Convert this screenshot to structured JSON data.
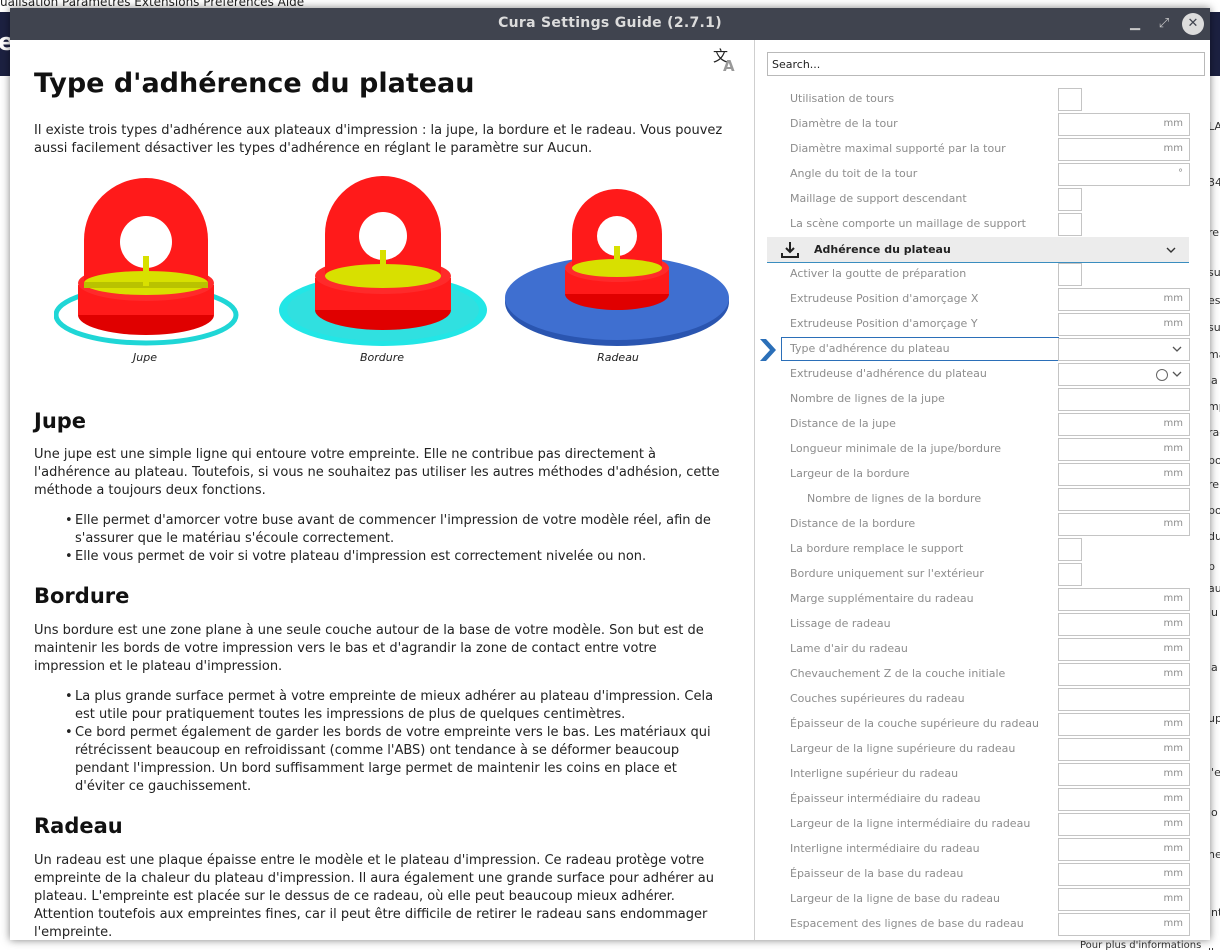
{
  "background": {
    "menubar": "ualisation  Paramètres  Extensions  Préférences  Aide",
    "header_letter": "er",
    "right_fragments": [
      "LA",
      "34",
      "re",
      "sup",
      "es",
      "su",
      "ma",
      "la",
      "mp",
      "rac",
      "po",
      "re s",
      "po",
      "du",
      "p",
      "au",
      "ju",
      "la",
      "up",
      "l'e",
      "io",
      "hev",
      "int",
      "lle"
    ],
    "bottom_fragment": "Pour plus d'informations"
  },
  "window": {
    "title": "Cura Settings Guide (2.7.1)",
    "minimize_glyph": "▁",
    "maximize_glyph": "⤢",
    "close_glyph": "✕"
  },
  "article": {
    "title": "Type d'adhérence du plateau",
    "intro": "Il existe trois types d'adhérence aux plateaux d'impression : la jupe, la bordure et le radeau. Vous pouvez aussi facilement désactiver les types d'adhérence en réglant le paramètre sur Aucun.",
    "figures": [
      {
        "caption": "Jupe"
      },
      {
        "caption": "Bordure"
      },
      {
        "caption": "Radeau"
      }
    ],
    "sections": [
      {
        "heading": "Jupe",
        "text": "Une jupe est une simple ligne qui entoure votre empreinte. Elle ne contribue pas directement à l'adhérence au plateau. Toutefois, si vous ne souhaitez pas utiliser les autres méthodes d'adhésion, cette méthode a toujours deux fonctions.",
        "bullets": [
          "Elle permet d'amorcer votre buse avant de commencer l'impression de votre modèle réel, afin de s'assurer que le matériau s'écoule correctement.",
          "Elle vous permet de voir si votre plateau d'impression est correctement nivelée ou non."
        ]
      },
      {
        "heading": "Bordure",
        "text": "Uns bordure est une zone plane à une seule couche autour de la base de votre modèle. Son but est de maintenir les bords de votre impression vers le bas et d'agrandir la zone de contact entre votre impression et le plateau d'impression.",
        "bullets": [
          "La plus grande surface permet à votre empreinte de mieux adhérer au plateau d'impression. Cela est utile pour pratiquement toutes les impressions de plus de quelques centimètres.",
          "Ce bord permet également de garder les bords de votre empreinte vers le bas. Les matériaux qui rétrécissent beaucoup en refroidissant (comme l'ABS) ont tendance à se déformer beaucoup pendant l'impression. Un bord suffisamment large permet de maintenir les coins en place et d'éviter ce gauchissement."
        ]
      },
      {
        "heading": "Radeau",
        "text": "Un radeau est une plaque épaisse entre le modèle et le plateau d'impression. Ce radeau protège votre empreinte de la chaleur du plateau d'impression. Il aura également une grande surface pour adhérer au plateau. L'empreinte est placée sur le dessus de ce radeau, où elle peut beaucoup mieux adhérer. Attention toutefois aux empreintes fines, car il peut être difficile de retirer le radeau sans endommager l'empreinte."
      }
    ],
    "colors": {
      "model_red": "#ff1a1a",
      "model_yellow": "#d8e000",
      "skirt_cyan": "#1fd6d6",
      "brim_cyan": "#22e6e6",
      "raft_blue": "#3f6fd0"
    }
  },
  "settings": {
    "search_placeholder": "Search...",
    "support_rows": [
      {
        "label": "Utilisation de tours",
        "kind": "check"
      },
      {
        "label": "Diamètre de la tour",
        "kind": "field",
        "unit": "mm"
      },
      {
        "label": "Diamètre maximal supporté par la tour",
        "kind": "field",
        "unit": "mm"
      },
      {
        "label": "Angle du toit de la tour",
        "kind": "field",
        "unit": "°"
      },
      {
        "label": "Maillage de support descendant",
        "kind": "check"
      },
      {
        "label": "La scène comporte un maillage de support",
        "kind": "check"
      }
    ],
    "category": {
      "label": "Adhérence du plateau",
      "icon": "download-tray-icon"
    },
    "adhesion_rows": [
      {
        "label": "Activer la goutte de préparation",
        "kind": "check"
      },
      {
        "label": "Extrudeuse Position d'amorçage X",
        "kind": "field",
        "unit": "mm"
      },
      {
        "label": "Extrudeuse Position d'amorçage Y",
        "kind": "field",
        "unit": "mm"
      },
      {
        "label": "Type d'adhérence du plateau",
        "kind": "select",
        "active": true
      },
      {
        "label": "Extrudeuse d'adhérence du plateau",
        "kind": "extruder"
      },
      {
        "label": "Nombre de lignes de la jupe",
        "kind": "field",
        "unit": ""
      },
      {
        "label": "Distance de la jupe",
        "kind": "field",
        "unit": "mm"
      },
      {
        "label": "Longueur minimale de la jupe/bordure",
        "kind": "field",
        "unit": "mm"
      },
      {
        "label": "Largeur de la bordure",
        "kind": "field",
        "unit": "mm"
      },
      {
        "label": "Nombre de lignes de la bordure",
        "kind": "field",
        "unit": "",
        "indent": true
      },
      {
        "label": "Distance de la bordure",
        "kind": "field",
        "unit": "mm"
      },
      {
        "label": "La bordure remplace le support",
        "kind": "check"
      },
      {
        "label": "Bordure uniquement sur l'extérieur",
        "kind": "check"
      },
      {
        "label": "Marge supplémentaire du radeau",
        "kind": "field",
        "unit": "mm"
      },
      {
        "label": "Lissage de radeau",
        "kind": "field",
        "unit": "mm"
      },
      {
        "label": "Lame d'air du radeau",
        "kind": "field",
        "unit": "mm"
      },
      {
        "label": "Chevauchement Z de la couche initiale",
        "kind": "field",
        "unit": "mm"
      },
      {
        "label": "Couches supérieures du radeau",
        "kind": "field",
        "unit": ""
      },
      {
        "label": "Épaisseur de la couche supérieure du radeau",
        "kind": "field",
        "unit": "mm"
      },
      {
        "label": "Largeur de la ligne supérieure du radeau",
        "kind": "field",
        "unit": "mm"
      },
      {
        "label": "Interligne supérieur du radeau",
        "kind": "field",
        "unit": "mm"
      },
      {
        "label": "Épaisseur intermédiaire du radeau",
        "kind": "field",
        "unit": "mm"
      },
      {
        "label": "Largeur de la ligne intermédiaire du radeau",
        "kind": "field",
        "unit": "mm"
      },
      {
        "label": "Interligne intermédiaire du radeau",
        "kind": "field",
        "unit": "mm"
      },
      {
        "label": "Épaisseur de la base du radeau",
        "kind": "field",
        "unit": "mm"
      },
      {
        "label": "Largeur de la ligne de base du radeau",
        "kind": "field",
        "unit": "mm"
      },
      {
        "label": "Espacement des lignes de base du radeau",
        "kind": "field",
        "unit": "mm"
      }
    ]
  }
}
